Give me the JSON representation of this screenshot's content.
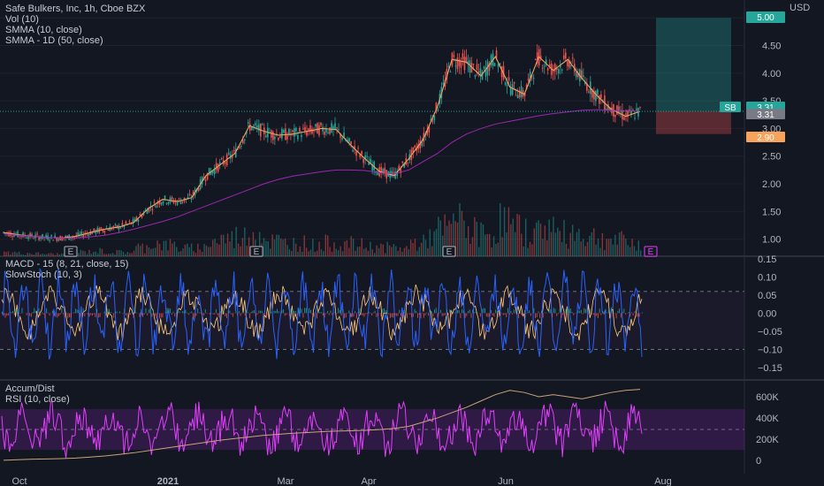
{
  "legend": {
    "title": "Safe Bulkers, Inc, 1h, Cboe BZX",
    "vol": "Vol (10)",
    "smma1": "SMMA (10, close)",
    "smma2": "SMMA - 1D (50, close)",
    "macd": "MACD - 15 (8, 21, close, 15)",
    "stoch": "SlowStoch (10, 3)",
    "ad": "Accum/Dist",
    "rsi": "RSI (10, close)"
  },
  "currency": "USD",
  "price_tags": {
    "target": "5.00",
    "ticker": "SB",
    "last": "3.31",
    "last2": "3.31",
    "stop": "2.90"
  },
  "earnings_marker": "E",
  "colors": {
    "background": "#131722",
    "up": "#26a69a",
    "down": "#ef5350",
    "smma": "#f7a35c",
    "smma_daily": "#9c27b0",
    "macd": "#2962ff",
    "stoch": "#ffcc80",
    "rsi": "#e040fb",
    "ad": "#c9a37a"
  },
  "chart_data": [
    {
      "type": "candlestick",
      "title": "Safe Bulkers, Inc, 1h, Cboe BZX",
      "ylim": [
        0.85,
        5.1
      ],
      "y_ticks": [
        "5.00",
        "4.50",
        "4.00",
        "3.50",
        "3.00",
        "2.50",
        "2.00",
        "1.50",
        "1.00"
      ],
      "x_ticks": [
        "Oct",
        "2021",
        "Mar",
        "Apr",
        "Jun",
        "Aug"
      ],
      "series": [
        {
          "name": "SMMA (10, close)",
          "values": [
            1.12,
            1.08,
            1.05,
            1.03,
            1.02,
            1.05,
            1.12,
            1.18,
            1.22,
            1.3,
            1.55,
            1.72,
            1.68,
            1.75,
            2.15,
            2.35,
            2.55,
            3.05,
            2.95,
            2.88,
            2.9,
            2.95,
            3.0,
            2.98,
            2.7,
            2.45,
            2.22,
            2.15,
            2.45,
            2.8,
            3.4,
            4.25,
            4.2,
            3.95,
            4.3,
            3.75,
            3.62,
            4.3,
            4.05,
            4.25,
            3.9,
            3.6,
            3.35,
            3.22,
            3.31
          ]
        },
        {
          "name": "SMMA - 1D (50, close)",
          "values": [
            1.1,
            1.07,
            1.05,
            1.03,
            1.02,
            1.02,
            1.04,
            1.07,
            1.12,
            1.18,
            1.25,
            1.32,
            1.4,
            1.5,
            1.6,
            1.7,
            1.8,
            1.9,
            2.0,
            2.08,
            2.14,
            2.18,
            2.22,
            2.25,
            2.25,
            2.24,
            2.2,
            2.18,
            2.25,
            2.4,
            2.55,
            2.75,
            2.9,
            3.0,
            3.08,
            3.13,
            3.18,
            3.23,
            3.27,
            3.3,
            3.33,
            3.34,
            3.33,
            3.32,
            3.31
          ]
        }
      ],
      "volume": [
        0.08,
        0.07,
        0.06,
        0.05,
        0.05,
        0.1,
        0.12,
        0.09,
        0.1,
        0.2,
        0.3,
        0.25,
        0.18,
        0.2,
        0.35,
        0.4,
        0.45,
        0.55,
        0.35,
        0.3,
        0.3,
        0.25,
        0.3,
        0.28,
        0.25,
        0.22,
        0.2,
        0.18,
        0.3,
        0.45,
        0.6,
        0.9,
        0.55,
        0.5,
        0.8,
        0.6,
        0.55,
        0.7,
        0.5,
        0.55,
        0.45,
        0.4,
        0.35,
        0.3,
        0.25
      ],
      "earnings_markers": 5,
      "position": {
        "target": 5.0,
        "entry": 3.31,
        "stop": 2.9
      }
    },
    {
      "type": "line",
      "series": [
        {
          "name": "MACD - 15 (8, 21, close, 15)"
        },
        {
          "name": "SlowStoch (10, 3)"
        }
      ],
      "y_ticks": [
        "0.15",
        "0.10",
        "0.05",
        "0.00",
        "−0.05",
        "−0.10",
        "−0.15"
      ],
      "ylim": [
        -0.17,
        0.15
      ]
    },
    {
      "type": "line",
      "series": [
        {
          "name": "Accum/Dist"
        },
        {
          "name": "RSI (10, close)"
        }
      ],
      "y_ticks": [
        "600K",
        "400K",
        "200K",
        "0"
      ],
      "ylim": [
        -60000,
        700000
      ],
      "ad_values": [
        0,
        5000,
        10000,
        12000,
        15000,
        20000,
        30000,
        40000,
        55000,
        70000,
        90000,
        110000,
        130000,
        150000,
        170000,
        190000,
        205000,
        220000,
        235000,
        245000,
        255000,
        262000,
        270000,
        275000,
        278000,
        282000,
        290000,
        300000,
        320000,
        360000,
        400000,
        450000,
        500000,
        560000,
        620000,
        660000,
        640000,
        600000,
        620000,
        600000,
        580000,
        610000,
        640000,
        660000,
        670000
      ]
    }
  ]
}
